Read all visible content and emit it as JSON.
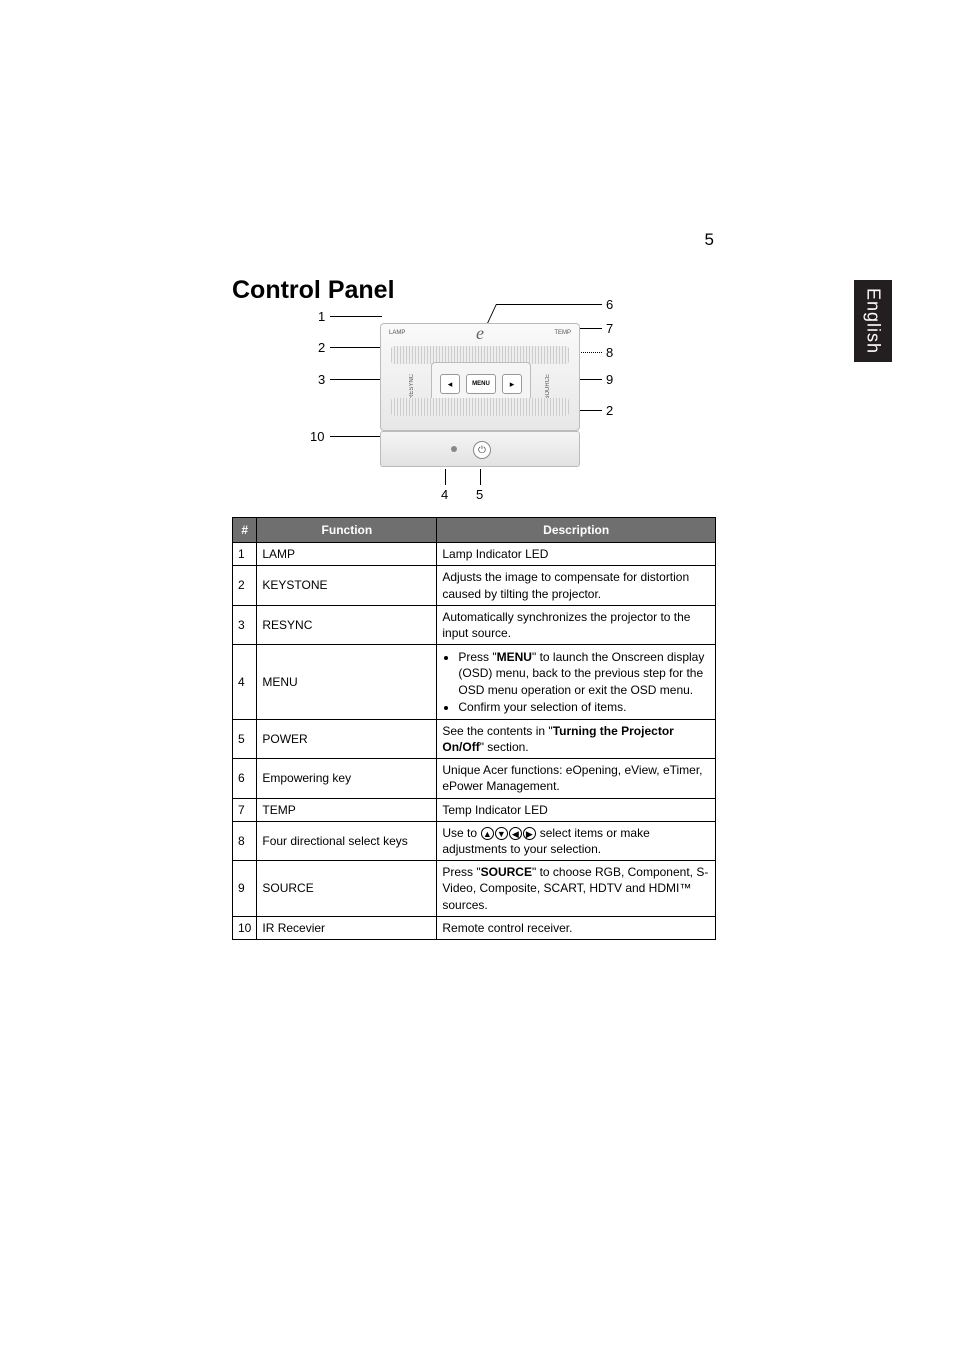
{
  "page_number": "5",
  "side_tab": "English",
  "title": "Control Panel",
  "diagram": {
    "panel_labels": {
      "lamp": "LAMP",
      "temp": "TEMP",
      "resync": "RESYNC",
      "source": "SOURCE",
      "menu": "MENU",
      "brand": "e",
      "power": "⏻"
    },
    "callouts": {
      "c1": "1",
      "c2": "2",
      "c3": "3",
      "c4": "4",
      "c5": "5",
      "c6": "6",
      "c7": "7",
      "c8": "8",
      "c9": "9",
      "c2b": "2",
      "c10": "10"
    }
  },
  "table": {
    "headers": {
      "num": "#",
      "func": "Function",
      "desc": "Description"
    },
    "rows": [
      {
        "num": "1",
        "func": "LAMP",
        "desc": "Lamp Indicator LED"
      },
      {
        "num": "2",
        "func": "KEYSTONE",
        "desc": "Adjusts the image to compensate for distortion caused by tilting the projector."
      },
      {
        "num": "3",
        "func": "RESYNC",
        "desc": "Automatically synchronizes the projector to the input source."
      },
      {
        "num": "4",
        "func": "MENU",
        "desc_list": [
          {
            "prefix": "Press \"",
            "bold": "MENU",
            "suffix": "\" to launch the Onscreen display (OSD) menu, back to the previous step for the OSD menu operation or exit the OSD menu."
          },
          {
            "text": "Confirm your selection of items."
          }
        ]
      },
      {
        "num": "5",
        "func": "POWER",
        "desc_parts": {
          "p1": "See the contents in \"",
          "b1": "Turning the Projector On/Off",
          "p2": "\" section."
        }
      },
      {
        "num": "6",
        "func": "Empowering key",
        "desc": "Unique Acer functions: eOpening, eView, eTimer, ePower Management."
      },
      {
        "num": "7",
        "func": "TEMP",
        "desc": "Temp Indicator LED"
      },
      {
        "num": "8",
        "func": "Four directional select keys",
        "desc_parts": {
          "p1": "Use to ",
          "p2": " select items or make adjustments to your selection."
        }
      },
      {
        "num": "9",
        "func": "SOURCE",
        "desc_parts": {
          "p1": "Press \"",
          "b1": "SOURCE",
          "p2": "\" to choose RGB, Component, S-Video, Composite, SCART, HDTV and HDMI™ sources."
        }
      },
      {
        "num": "10",
        "func": "IR Recevier",
        "desc": "Remote control receiver."
      }
    ]
  }
}
